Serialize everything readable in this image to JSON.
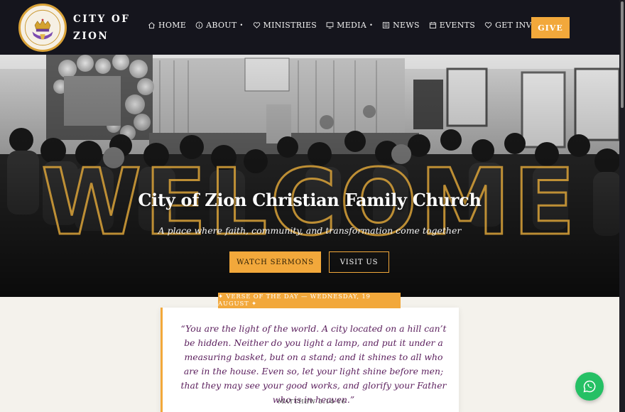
{
  "brand": {
    "line1": "CITY OF",
    "line2": "ZION",
    "logo_text": "City Of Zion"
  },
  "nav": {
    "items": [
      {
        "label": "HOME",
        "icon": "home-icon",
        "caret": false
      },
      {
        "label": "ABOUT",
        "icon": "info-icon",
        "caret": true
      },
      {
        "label": "MINISTRIES",
        "icon": "heart-icon",
        "caret": false
      },
      {
        "label": "MEDIA",
        "icon": "monitor-icon",
        "caret": true
      },
      {
        "label": "NEWS",
        "icon": "newspaper-icon",
        "caret": false
      },
      {
        "label": "EVENTS",
        "icon": "calendar-icon",
        "caret": false
      },
      {
        "label": "GET INVOLVED",
        "icon": "heart-icon",
        "caret": true
      }
    ],
    "give_label": "GIVE"
  },
  "hero": {
    "watermark": "WELCOME",
    "title": "City of Zion Christian Family Church",
    "subtitle": "A place where faith, community, and transformation come together",
    "primary_button": "WATCH SERMONS",
    "secondary_button": "VISIT US"
  },
  "verse": {
    "tag": "✦ VERSE OF THE DAY — WEDNESDAY, 19 AUGUST ✦",
    "text": "“You are the light of the world. A city located on a hill can’t be hidden. Neither do you light a lamp, and put it under a measuring basket, but on a stand; and it shines to all who are in the house. Even so, let your light shine before men; that they may see your good works, and glorify your Father who is in heaven.”",
    "reference": "MATTHEW 5:14-16"
  },
  "colors": {
    "accent": "#f2a83b",
    "nav_bg": "#15151d",
    "verse_text": "#5a1e5c",
    "whatsapp": "#25c064"
  },
  "whatsapp": {
    "icon": "whatsapp-icon"
  }
}
